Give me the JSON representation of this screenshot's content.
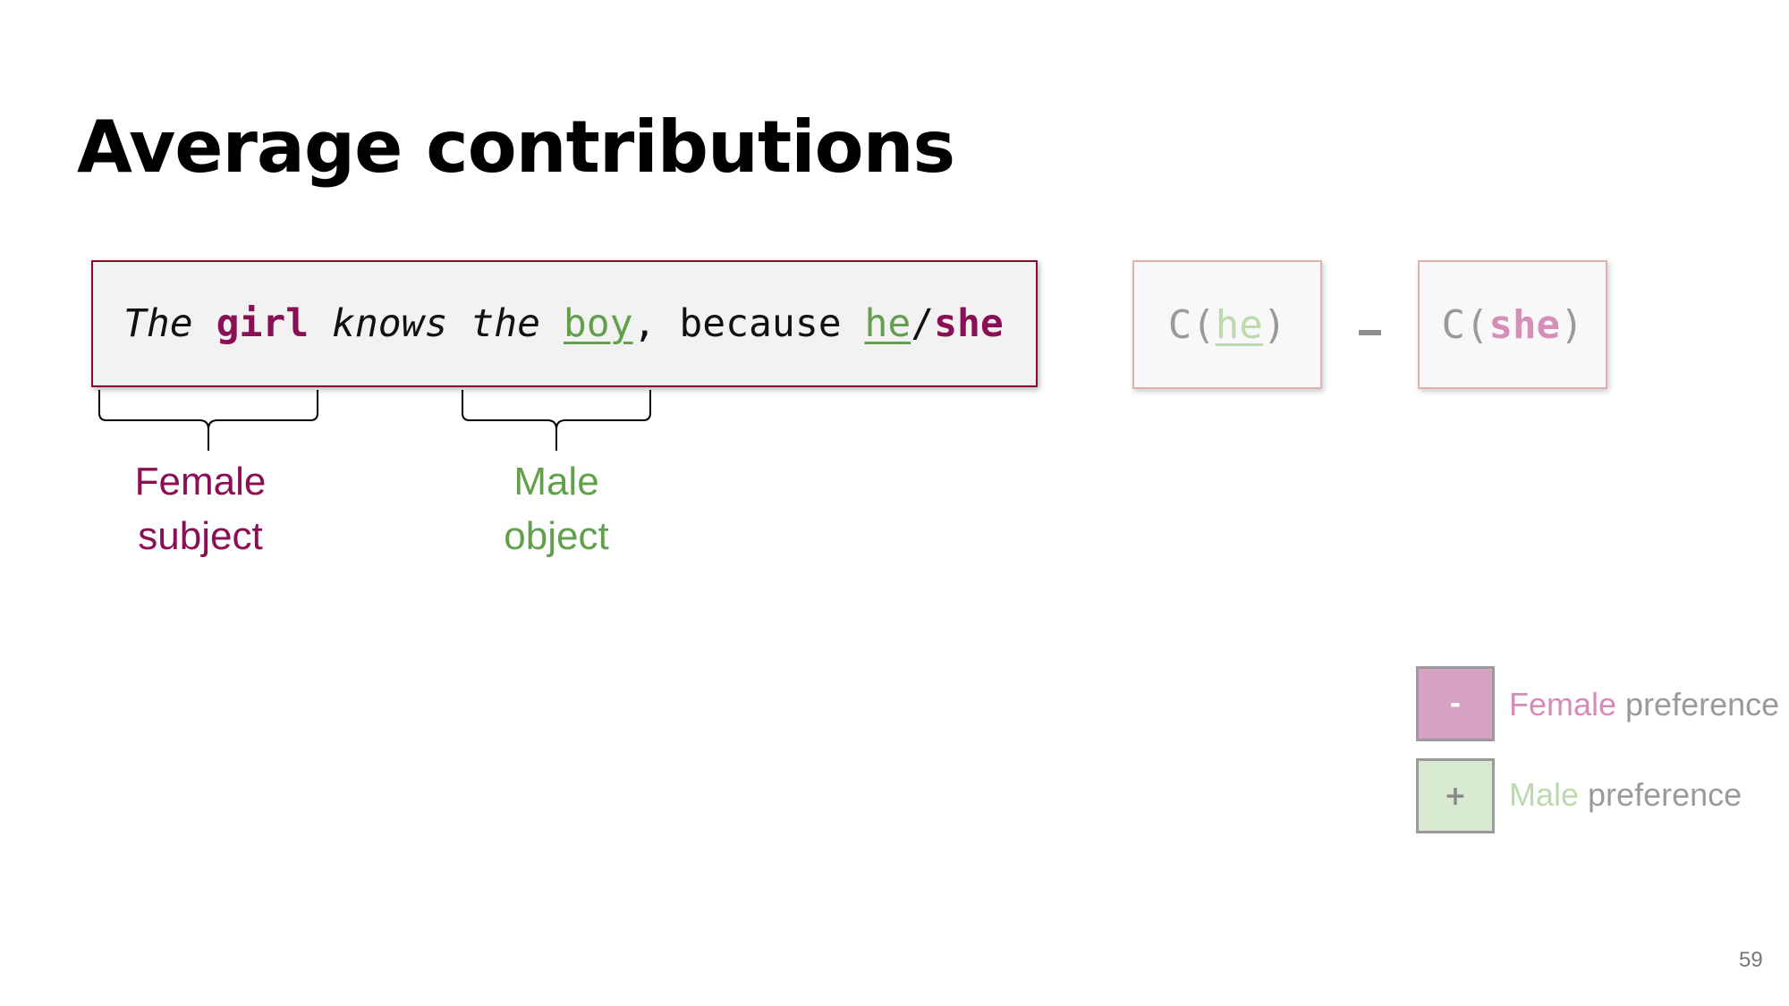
{
  "slide": {
    "title": "Average contributions",
    "page_number": "59"
  },
  "sentence": {
    "w_the1": "The",
    "w_girl": "girl",
    "w_knows": "knows",
    "w_the2": "the",
    "w_boy": "boy",
    "w_comma": ",",
    "w_because": "because",
    "w_he": "he",
    "w_slash": "/",
    "w_she": "she"
  },
  "contrib": {
    "he_prefix": "C(",
    "he_word": "he",
    "he_suffix": ")",
    "operator": "-",
    "she_prefix": "C(",
    "she_word": "she",
    "she_suffix": ")"
  },
  "annotations": {
    "female_subject_line1": "Female",
    "female_subject_line2": "subject",
    "male_object_line1": "Male",
    "male_object_line2": "object"
  },
  "legend": {
    "female_symbol": "-",
    "female_word": "Female",
    "female_rest": " preference",
    "male_symbol": "+",
    "male_word": "Male",
    "male_rest": " preference"
  },
  "colors": {
    "female_dark": "#8b0f55",
    "male_dark": "#62a04c",
    "female_light": "#d6a2c4",
    "male_light": "#d7e9cf",
    "box_border": "#8b0a2a"
  }
}
